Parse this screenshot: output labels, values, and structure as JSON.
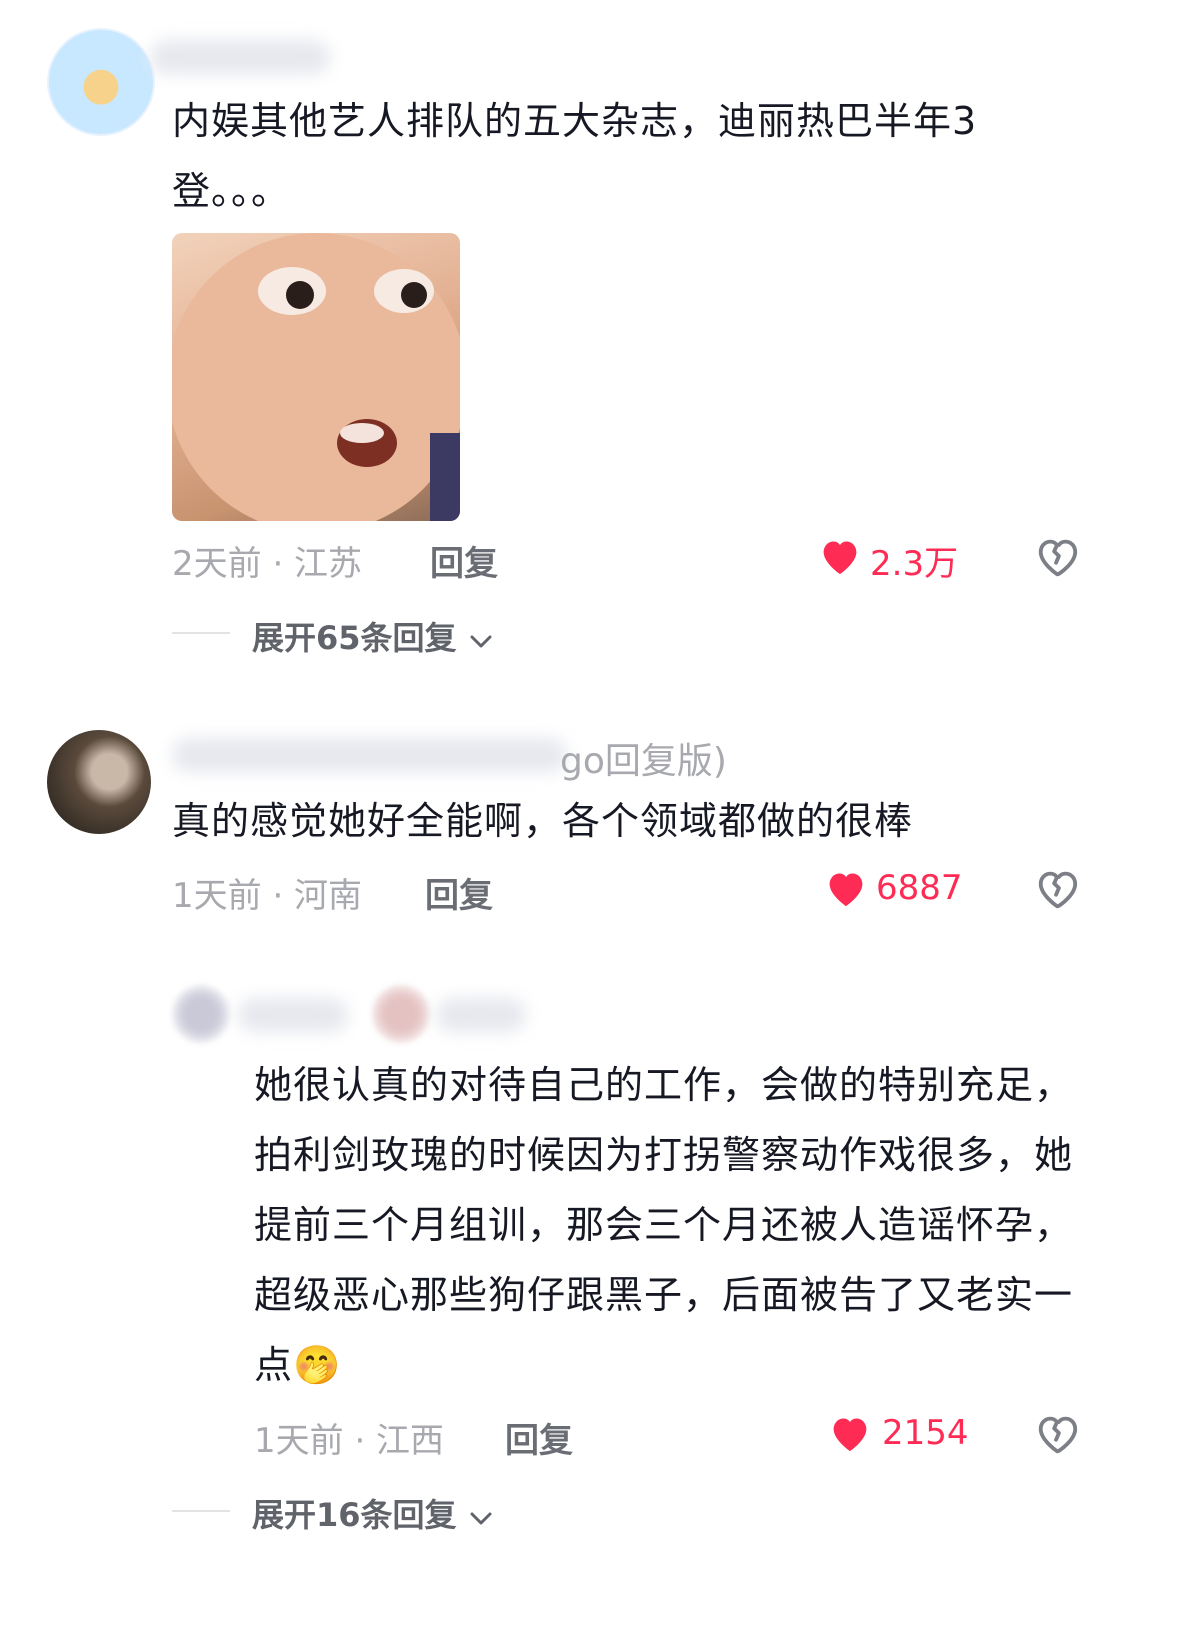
{
  "comments": [
    {
      "text": "内娱其他艺人排队的五大杂志，迪丽热巴半年3登。。。",
      "time_location": "2天前 · 江苏",
      "reply_label": "回复",
      "likes": "2.3万",
      "expand_label": "展开65条回复"
    },
    {
      "username_visible": "go回复版)",
      "text": "真的感觉她好全能啊，各个领域都做的很棒",
      "time_location": "1天前 · 河南",
      "reply_label": "回复",
      "likes": "6887"
    },
    {
      "text": "她很认真的对待自己的工作，会做的特别充足，拍利剑玫瑰的时候因为打拐警察动作戏很多，她提前三个月组训，那会三个月还被人造谣怀孕，超级恶心那些狗仔跟黑子，后面被告了又老实一点🤭",
      "time_location": "1天前 · 江西",
      "reply_label": "回复",
      "likes": "2154",
      "expand_label": "展开16条回复"
    }
  ],
  "colors": {
    "like": "#fe2c55",
    "meta": "#a8a9ae",
    "text": "#161823"
  },
  "icons": {
    "like": "heart-filled-icon",
    "dislike": "broken-heart-icon",
    "expand": "chevron-down-icon"
  }
}
